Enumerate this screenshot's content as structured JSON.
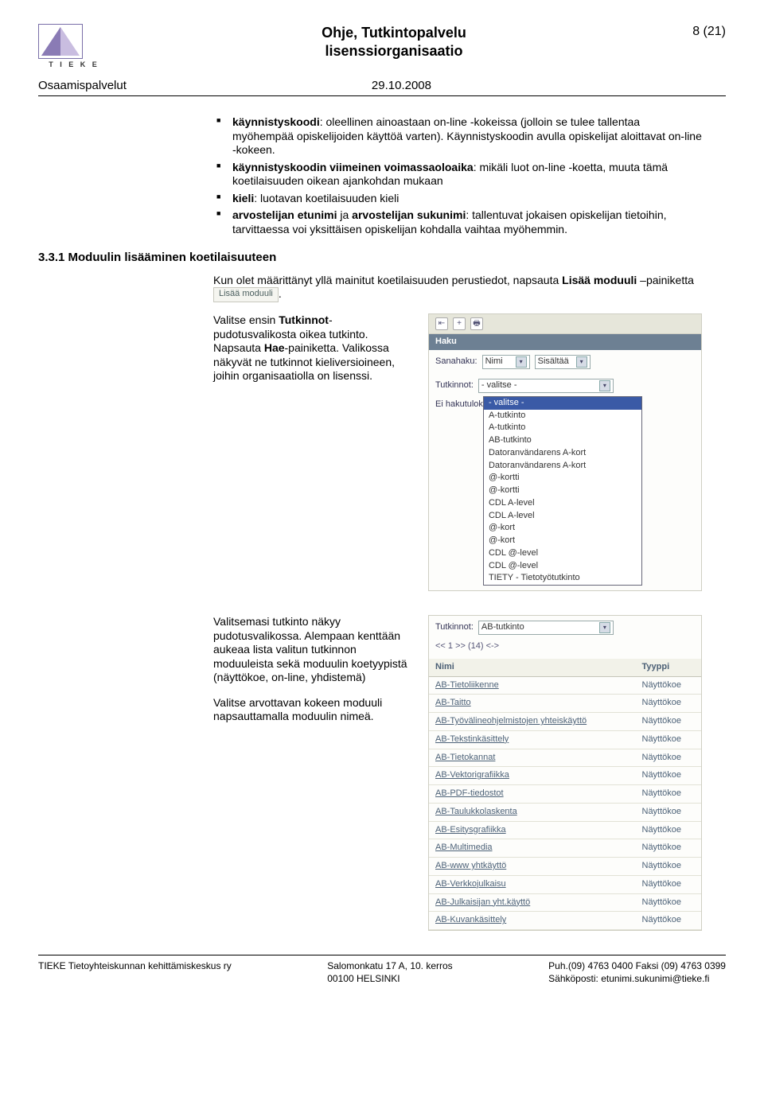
{
  "header": {
    "logo_text": "T I E K E",
    "title_line1": "Ohje, Tutkintopalvelu",
    "title_line2": "lisenssiorganisaatio",
    "page_num": "8 (21)"
  },
  "subhead": {
    "left": "Osaamispalvelut",
    "date": "29.10.2008"
  },
  "bullets": {
    "b1_strong": "käynnistyskoodi",
    "b1_rest": ": oleellinen ainoastaan on-line -kokeissa (jolloin se tulee tallentaa myöhempää opiskelijoiden käyttöä varten). Käynnistyskoodin avulla opiskelijat aloittavat on-line -kokeen.",
    "b2_strong": "käynnistyskoodin viimeinen voimassaoloaika",
    "b2_rest": ": mikäli luot on-line -koetta, muuta tämä koetilaisuuden oikean ajankohdan mukaan",
    "b3_strong": "kieli",
    "b3_rest": ": luotavan koetilaisuuden kieli",
    "b4a_strong": "arvostelijan etunimi",
    "b4_mid": " ja ",
    "b4b_strong": "arvostelijan sukunimi",
    "b4_rest": ": tallentuvat jokaisen opiskelijan tietoihin, tarvittaessa voi yksittäisen opiskelijan kohdalla vaihtaa myöhemmin."
  },
  "section_heading": "3.3.1 Moduulin lisääminen koetilaisuuteen",
  "intro": {
    "p1a": "Kun olet määrittänyt yllä mainitut koetilaisuuden perustiedot, napsauta ",
    "p1_strong": "Lisää moduuli",
    "p1b": " –painiketta ",
    "btn_label": "Lisää moduuli",
    "p1_end": "."
  },
  "block1": {
    "text_a": "Valitse ensin ",
    "strong1": "Tutkinnot",
    "text_b": "-pudotusvalikosta oikea tutkinto. Napsauta ",
    "strong2": "Hae",
    "text_c": "-painiketta. Valikossa näkyvät ne tutkinnot kieliversioineen, joihin organisaatiolla on lisenssi.",
    "shot": {
      "toolbar_icons": [
        "⇤",
        "+",
        "🖶"
      ],
      "haku_label": "Haku",
      "sanahaku_label": "Sanahaku:",
      "sanahaku_sel": "Nimi",
      "sisaltaa_sel": "Sisältää",
      "tutkinnot_label": "Tutkinnot:",
      "tutkinnot_sel": "- valitse -",
      "ei_haku": "Ei hakutulok",
      "options": [
        "- valitse -",
        "A-tutkinto",
        "A-tutkinto",
        "AB-tutkinto",
        "Datoranvändarens A-kort",
        "Datoranvändarens A-kort",
        "@-kortti",
        "@-kortti",
        "CDL A-level",
        "CDL A-level",
        "@-kort",
        "@-kort",
        "CDL @-level",
        "CDL @-level",
        "TIETY - Tietotyötutkinto"
      ]
    }
  },
  "block2": {
    "p1": "Valitsemasi tutkinto näkyy pudotusvalikossa. Alempaan kenttään aukeaa lista valitun tutkinnon moduuleista sekä moduulin koetyypistä (näyttökoe, on-line, yhdistemä)",
    "p2": "Valitse arvottavan kokeen moduuli napsauttamalla moduulin nimeä.",
    "shot": {
      "tutkinnot_label": "Tutkinnot:",
      "tutkinnot_sel": "AB-tutkinto",
      "pager": "<< 1 >> (14) <->",
      "col_name": "Nimi",
      "col_type": "Tyyppi",
      "rows": [
        {
          "name": "AB-Tietoliikenne",
          "type": "Näyttökoe"
        },
        {
          "name": "AB-Taitto",
          "type": "Näyttökoe"
        },
        {
          "name": "AB-Työvälineohjelmistojen yhteiskäyttö",
          "type": "Näyttökoe"
        },
        {
          "name": "AB-Tekstinkäsittely",
          "type": "Näyttökoe"
        },
        {
          "name": "AB-Tietokannat",
          "type": "Näyttökoe"
        },
        {
          "name": "AB-Vektorigrafiikka",
          "type": "Näyttökoe"
        },
        {
          "name": "AB-PDF-tiedostot",
          "type": "Näyttökoe"
        },
        {
          "name": "AB-Taulukkolaskenta",
          "type": "Näyttökoe"
        },
        {
          "name": "AB-Esitysgrafiikka",
          "type": "Näyttökoe"
        },
        {
          "name": "AB-Multimedia",
          "type": "Näyttökoe"
        },
        {
          "name": "AB-www yhtkäyttö",
          "type": "Näyttökoe"
        },
        {
          "name": "AB-Verkkojulkaisu",
          "type": "Näyttökoe"
        },
        {
          "name": "AB-Julkaisijan yht.käyttö",
          "type": "Näyttökoe"
        },
        {
          "name": "AB-Kuvankäsittely",
          "type": "Näyttökoe"
        }
      ]
    }
  },
  "footer": {
    "left1": "TIEKE Tietoyhteiskunnan kehittämiskeskus ry",
    "mid1": "Salomonkatu 17 A, 10. kerros",
    "mid2": "00100 HELSINKI",
    "right1": "Puh.(09) 4763 0400 Faksi (09) 4763 0399",
    "right2": "Sähköposti: etunimi.sukunimi@tieke.fi"
  }
}
